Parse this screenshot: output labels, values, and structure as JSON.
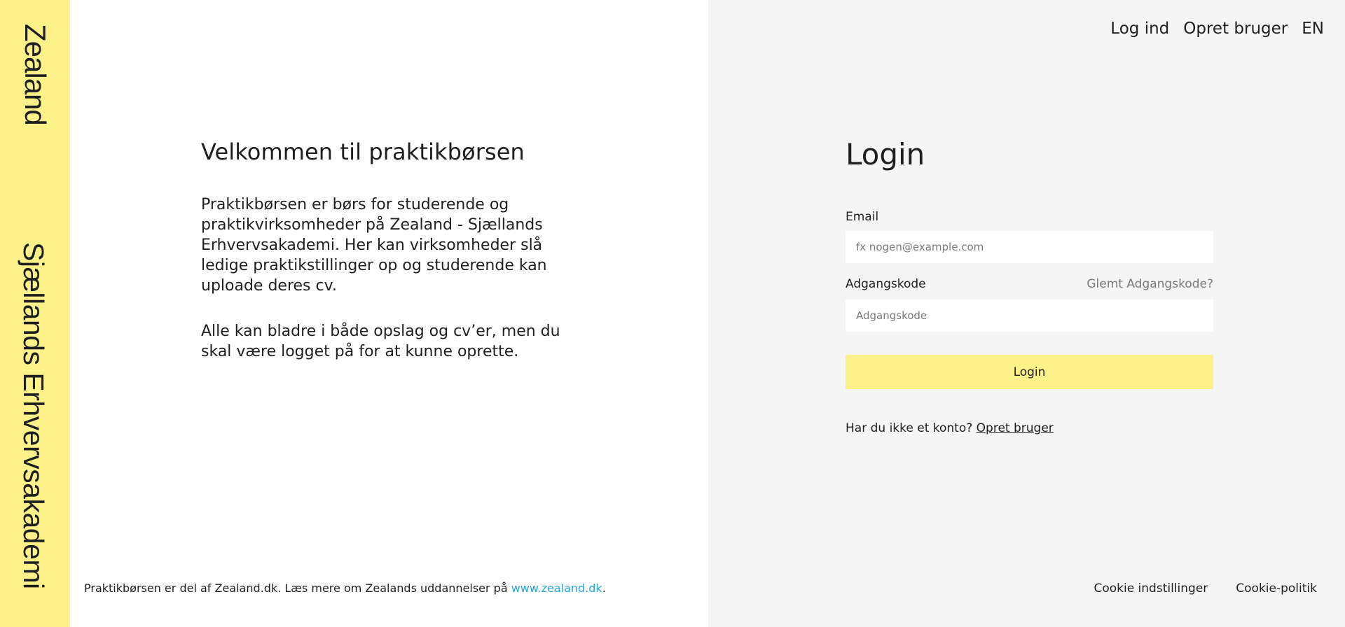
{
  "brand": {
    "line1": "Zealand",
    "line2": "Sjællands Erhvervsakademi"
  },
  "welcome": {
    "title": "Velkommen til praktikbørsen",
    "paragraph1": "Praktikbørsen er børs for studerende og praktikvirksomheder på Zealand - Sjællands Erhvervsakademi. Her kan virksomheder slå ledige praktikstillinger op og studerende kan uploade deres cv.",
    "paragraph2": "Alle kan bladre i både opslag og cv’er, men du skal være logget på for at kunne oprette."
  },
  "footer_left": {
    "text": "Praktikbørsen er del af Zealand.dk. Læs mere om Zealands uddannelser på ",
    "link": "www.zealand.dk",
    "suffix": "."
  },
  "topnav": {
    "login": "Log ind",
    "signup": "Opret bruger",
    "language": "EN"
  },
  "login_form": {
    "title": "Login",
    "email_label": "Email",
    "email_placeholder": "fx nogen@example.com",
    "email_value": "",
    "password_label": "Adgangskode",
    "forgot_link": "Glemt Adgangskode?",
    "password_placeholder": "Adgangskode",
    "password_value": "",
    "submit_label": "Login",
    "no_account_text": "Har du ikke et konto? ",
    "signup_link": "Opret bruger"
  },
  "footer_right": {
    "cookie_settings": "Cookie indstillinger",
    "cookie_policy": "Cookie-politik"
  },
  "colors": {
    "brand_yellow": "#fdf18a",
    "link_blue": "#2aa6d8",
    "panel_gray": "#f5f5f5"
  }
}
